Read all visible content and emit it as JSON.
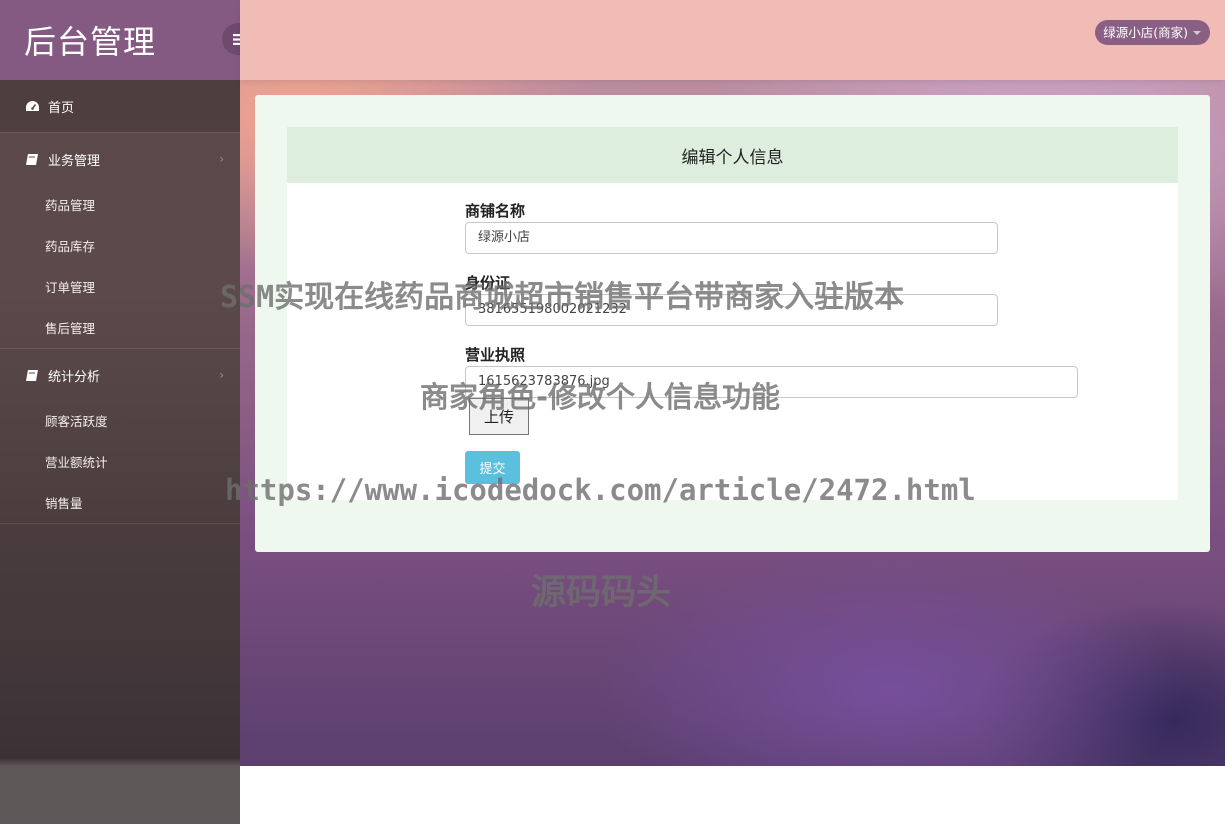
{
  "brand": {
    "title": "后台管理"
  },
  "header": {
    "user": "绿源小店(商家)"
  },
  "sidebar": {
    "home": "首页",
    "groups": [
      {
        "label": "业务管理",
        "items": [
          "药品管理",
          "药品库存",
          "订单管理",
          "售后管理"
        ]
      },
      {
        "label": "统计分析",
        "items": [
          "顾客活跃度",
          "营业额统计",
          "销售量"
        ]
      }
    ]
  },
  "form": {
    "title": "编辑个人信息",
    "shop_name_label": "商铺名称",
    "shop_name_value": "绿源小店",
    "id_label": "身份证",
    "id_value": "381655198002021232",
    "license_label": "营业执照",
    "license_value": "1615623783876.jpg",
    "upload_label": "上传",
    "submit_label": "提交"
  },
  "watermark": {
    "line1": "SSM实现在线药品商城超市销售平台带商家入驻版本",
    "line2": "商家角色-修改个人信息功能",
    "line3": "https://www.icodedock.com/article/2472.html",
    "line4": "源码码头"
  },
  "colors": {
    "brand_bg": "#855a82",
    "header_bg": "#f1bcb6",
    "submit_bg": "#5bc0de",
    "card_head_bg": "#ddeedf"
  }
}
